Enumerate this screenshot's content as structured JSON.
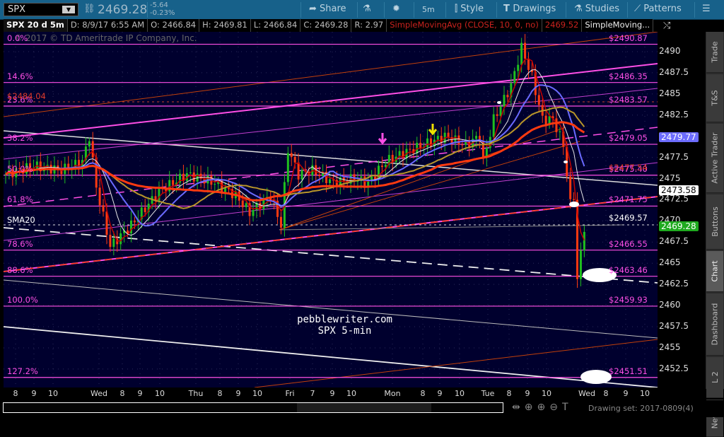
{
  "toolbar": {
    "symbol": "SPX",
    "price": "2469.28",
    "change": "-5.64",
    "change_pct": "-0.23%",
    "share": "Share",
    "interval": "5m",
    "style": "Style",
    "drawings": "Drawings",
    "studies": "Studies",
    "patterns": "Patterns"
  },
  "info": {
    "title": "SPX 20 d 5m",
    "date": "D: 8/9/17 6:55 AM",
    "open": "O: 2466.84",
    "high": "H: 2469.81",
    "low": "L: 2466.84",
    "close": "C: 2469.28",
    "range": "R: 2.97",
    "study": "SimpleMovingAvg (CLOSE, 10, 0, no)",
    "study_value": "2469.52",
    "study2": "SimpleMoving..."
  },
  "copyright": "2017 © TD Ameritrade IP Company, Inc.",
  "watermark": {
    "line1": "pebblewriter.com",
    "line2": "SPX 5-min"
  },
  "fib_levels": [
    {
      "pct": "0.0%",
      "price": 2490.87,
      "label": "$2490.87"
    },
    {
      "pct": "14.6%",
      "price": 2486.35,
      "label": "$2486.35"
    },
    {
      "pct": "23.6%",
      "price": 2483.57,
      "label": "$2483.57"
    },
    {
      "pct": "38.2%",
      "price": 2479.05,
      "label": "$2479.05"
    },
    {
      "pct": "50.0%",
      "price": 2475.4,
      "label": "$2475.40"
    },
    {
      "pct": "61.8%",
      "price": 2471.75,
      "label": "$2471.75"
    },
    {
      "pct": "78.6%",
      "price": 2466.55,
      "label": "$2466.55"
    },
    {
      "pct": "88.6%",
      "price": 2463.46,
      "label": "$2463.46"
    },
    {
      "pct": "100.0%",
      "price": 2459.93,
      "label": "$2459.93"
    },
    {
      "pct": "127.2%",
      "price": 2451.51,
      "label": "$2451.51"
    }
  ],
  "other_labels": {
    "red_left": "$2484.04",
    "red_right": "$2477.54",
    "sma20": "SMA20",
    "sma20_label": "$2469.57"
  },
  "y_axis": {
    "ticks": [
      "2490",
      "2487.5",
      "2485",
      "2482.5",
      "2477.5",
      "2475",
      "2472.5",
      "2470",
      "2467.5",
      "2465",
      "2462.5",
      "2460",
      "2457.5",
      "2455",
      "2452.5"
    ],
    "tag_blue": "2479.77",
    "tag_white": "2473.58",
    "tag_green": "2469.28"
  },
  "x_axis": [
    "8",
    "9",
    "10",
    "Wed",
    "8",
    "9",
    "10",
    "Thu",
    "8",
    "9",
    "10",
    "Fri",
    "7",
    "9",
    "10",
    "Mon",
    "8",
    "9",
    "10",
    "Tue",
    "8",
    "9",
    "10",
    "Wed",
    "8",
    "9",
    "10"
  ],
  "side_tabs": [
    "Trade",
    "T&S",
    "Active Trader",
    "Buttons",
    "Chart",
    "Dashboard",
    "L 2",
    "News"
  ],
  "drawing_set": "Drawing set: 2017-0809(4)",
  "colors": {
    "bg": "#00002e",
    "fib": "#ff4fe6",
    "up": "#1fbf1f",
    "down": "#ff3a10",
    "sma_fast": "#c40000",
    "sma_white": "#e8e8e8",
    "sma_blue": "#6a6aff",
    "sma_gold": "#b8952a",
    "sma_red": "#ff3a10"
  },
  "chart_data": {
    "type": "candlestick",
    "title": "SPX 20 d 5m",
    "ylim": [
      2450,
      2492
    ],
    "knots": [
      [
        0,
        2475.5
      ],
      [
        8,
        2476.5
      ],
      [
        16,
        2476
      ],
      [
        22,
        2477
      ],
      [
        24,
        2480
      ],
      [
        26,
        2474
      ],
      [
        30,
        2467
      ],
      [
        36,
        2469.5
      ],
      [
        44,
        2473.5
      ],
      [
        52,
        2475.5
      ],
      [
        60,
        2474.5
      ],
      [
        66,
        2473
      ],
      [
        70,
        2471
      ],
      [
        76,
        2473
      ],
      [
        79,
        2469.5
      ],
      [
        81,
        2478.5
      ],
      [
        84,
        2475.5
      ],
      [
        88,
        2476
      ],
      [
        94,
        2474.5
      ],
      [
        100,
        2475
      ],
      [
        104,
        2474.5
      ],
      [
        109,
        2477
      ],
      [
        114,
        2478
      ],
      [
        120,
        2479
      ],
      [
        126,
        2480
      ],
      [
        132,
        2479
      ],
      [
        136,
        2480
      ],
      [
        137,
        2477
      ],
      [
        140,
        2482
      ],
      [
        145,
        2486
      ],
      [
        148,
        2490.5
      ],
      [
        151,
        2487
      ],
      [
        154,
        2482
      ],
      [
        157,
        2482
      ],
      [
        160,
        2479
      ],
      [
        162,
        2472
      ],
      [
        163,
        2473
      ],
      [
        164,
        2463
      ],
      [
        166,
        2469.3
      ]
    ]
  }
}
